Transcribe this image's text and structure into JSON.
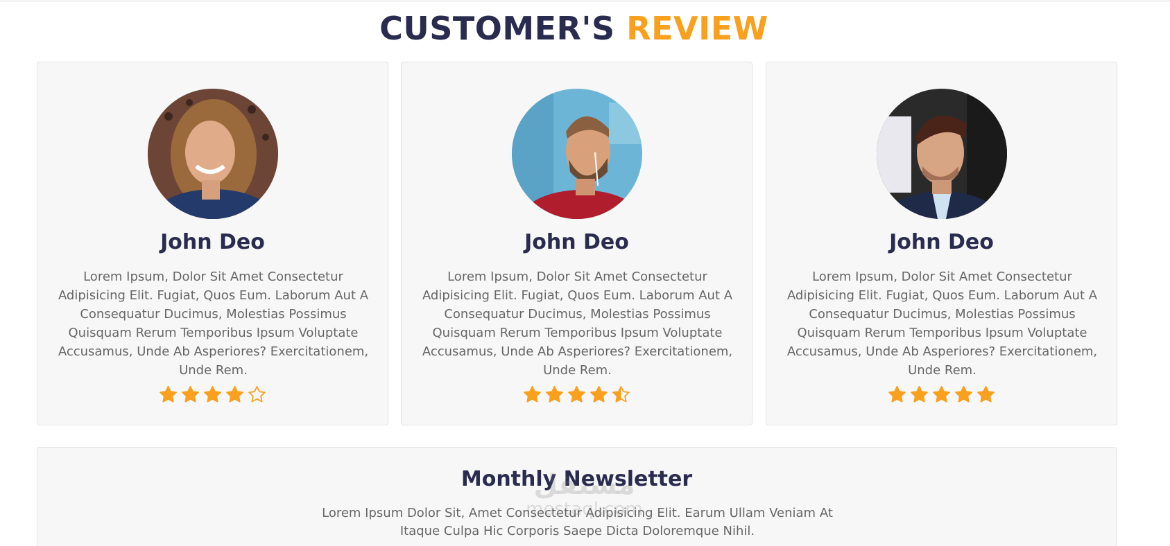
{
  "section": {
    "title_dark": "CUSTOMER'S",
    "title_accent": "REVIEW",
    "accent_color": "#f9a01e",
    "title_color": "#2a2c4f"
  },
  "reviews": [
    {
      "name": "John Deo",
      "text": "Lorem Ipsum, Dolor Sit Amet Consectetur Adipisicing Elit. Fugiat, Quos Eum. Laborum Aut A Consequatur Ducimus, Molestias Possimus Quisquam Rerum Temporibus Ipsum Voluptate Accusamus, Unde Ab Asperiores? Exercitationem, Unde Rem.",
      "rating": 4,
      "avatar": "woman-portrait"
    },
    {
      "name": "John Deo",
      "text": "Lorem Ipsum, Dolor Sit Amet Consectetur Adipisicing Elit. Fugiat, Quos Eum. Laborum Aut A Consequatur Ducimus, Molestias Possimus Quisquam Rerum Temporibus Ipsum Voluptate Accusamus, Unde Ab Asperiores? Exercitationem, Unde Rem.",
      "rating": 4.5,
      "avatar": "bearded-man-portrait"
    },
    {
      "name": "John Deo",
      "text": "Lorem Ipsum, Dolor Sit Amet Consectetur Adipisicing Elit. Fugiat, Quos Eum. Laborum Aut A Consequatur Ducimus, Molestias Possimus Quisquam Rerum Temporibus Ipsum Voluptate Accusamus, Unde Ab Asperiores? Exercitationem, Unde Rem.",
      "rating": 5,
      "avatar": "suited-man-portrait"
    }
  ],
  "newsletter": {
    "title": "Monthly Newsletter",
    "text": "Lorem Ipsum Dolor Sit, Amet Consectetur Adipisicing Elit. Earum Ullam Veniam At Itaque Culpa Hic Corporis Saepe Dicta Doloremque Nihil."
  },
  "watermark": {
    "logo": "مستقل",
    "site": "mostaql.com"
  },
  "icons": {
    "star_full": "star-icon",
    "star_half": "star-half-icon",
    "star_empty": "star-empty-icon"
  }
}
